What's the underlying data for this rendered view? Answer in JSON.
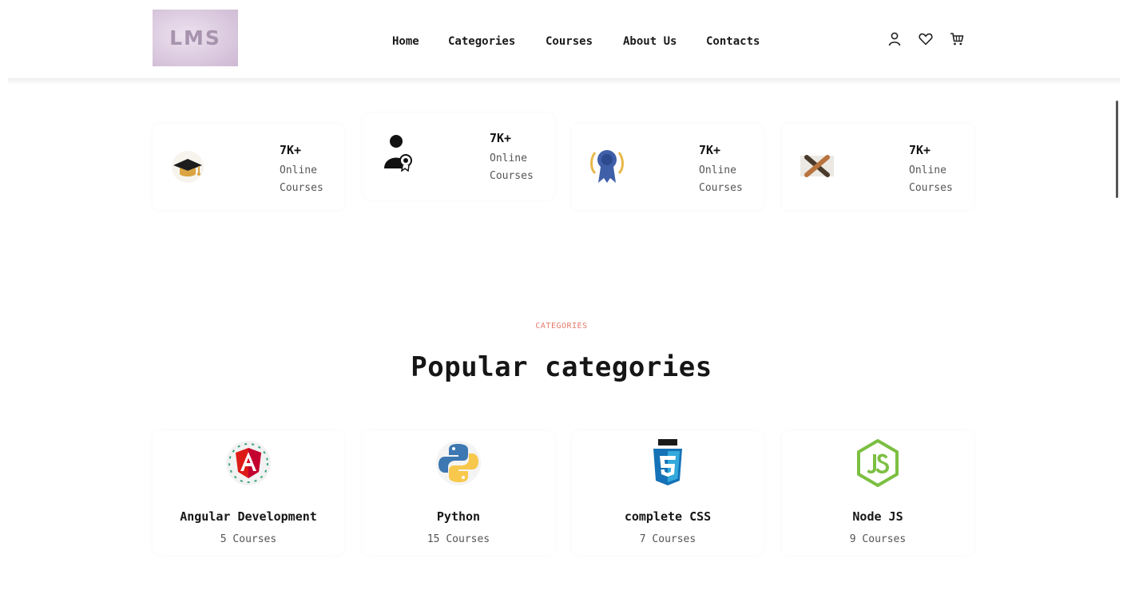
{
  "header": {
    "logo_text": "LMS",
    "nav": [
      "Home",
      "Categories",
      "Courses",
      "About Us",
      "Contacts"
    ],
    "icons": [
      "user-icon",
      "heart-icon",
      "cart-icon"
    ]
  },
  "stats": [
    {
      "icon": "graduation-cap-icon",
      "value": "7K+",
      "label": "Online Courses"
    },
    {
      "icon": "certified-person-icon",
      "value": "7K+",
      "label": "Online Courses"
    },
    {
      "icon": "award-ribbon-icon",
      "value": "7K+",
      "label": "Online Courses"
    },
    {
      "icon": "crossed-pencils-icon",
      "value": "7K+",
      "label": "Online Courses"
    }
  ],
  "categories_section": {
    "tag": "CATEGORIES",
    "title": "Popular categories",
    "items": [
      {
        "icon": "angular-icon",
        "name": "Angular Development",
        "count": "5 Courses"
      },
      {
        "icon": "python-icon",
        "name": "Python",
        "count": "15 Courses"
      },
      {
        "icon": "css3-icon",
        "name": "complete CSS",
        "count": "7 Courses"
      },
      {
        "icon": "nodejs-icon",
        "name": "Node JS",
        "count": "9 Courses"
      }
    ]
  },
  "colors": {
    "accent": "#e77a6a",
    "text": "#161616",
    "muted": "#555555"
  }
}
